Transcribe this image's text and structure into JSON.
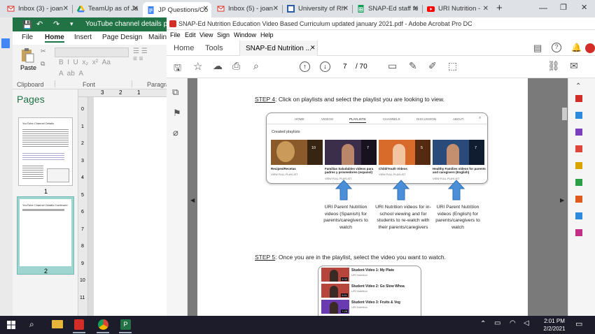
{
  "browser_tabs": [
    {
      "title": "Inbox (3) - joan",
      "icon": "gmail-icon",
      "color": "#d93025"
    },
    {
      "title": "TeamUp as of Ja",
      "icon": "google-drive-icon",
      "color": "#1a73e8"
    },
    {
      "title": "JP Questions/Co",
      "icon": "google-docs-icon",
      "color": "#4285f4"
    },
    {
      "title": "Inbox (5) - joan",
      "icon": "gmail-icon",
      "color": "#d93025"
    },
    {
      "title": "University of Rh",
      "icon": "uri-icon",
      "color": "#2a5caa"
    },
    {
      "title": "SNAP-Ed staff fe",
      "icon": "google-sheets-icon",
      "color": "#0f9d58"
    },
    {
      "title": "URI Nutrition -",
      "icon": "youtube-icon",
      "color": "#ff0000"
    }
  ],
  "publisher": {
    "title": "YouTube channel details page upd",
    "menu": [
      "File",
      "Home",
      "Insert",
      "Page Design",
      "Mailin"
    ],
    "ribbon_groups": [
      "Clipboard",
      "Font",
      "Paragrap"
    ],
    "paste_label": "Paste",
    "pages_title": "Pages",
    "page_numbers": [
      "1",
      "2"
    ],
    "thumb1_title": "YouTube Channel Details",
    "thumb2_title": "YouTube Channel Details Continued",
    "ruler_top": [
      "3",
      "2",
      "1"
    ],
    "ruler_left": [
      "0",
      "1",
      "2",
      "3",
      "4",
      "5",
      "6",
      "7",
      "8",
      "9",
      "10",
      "11"
    ]
  },
  "acrobat": {
    "title": "SNAP-Ed Nutrition Education Video Based Curriculum updated january 2021.pdf - Adobe Acrobat Pro DC",
    "menu": [
      "File",
      "Edit",
      "View",
      "Sign",
      "Window",
      "Help"
    ],
    "tabs": [
      "Home",
      "Tools",
      "SNAP-Ed Nutrition ..."
    ],
    "page_current": "7",
    "page_total": "/ 70"
  },
  "pdf": {
    "step4": "STEP 4: Click on playlists and select the playlist you are looking to view.",
    "step4_label": "STEP 4",
    "step4_text": ": Click on playlists and select the playlist you are looking to view.",
    "yt_nav": [
      "HOME",
      "VIDEOS",
      "PLAYLISTS",
      "CHANNELS",
      "DISCUSSION",
      "ABOUT"
    ],
    "created_playlists": "Created playlists",
    "playlists": [
      {
        "title": "Recipes/Recetas",
        "count": "10",
        "link": "VIEW FULL PLAYLIST",
        "color": "#8a5a2b"
      },
      {
        "title": "Familias Saludables videos para padres y proveedores (espanol)",
        "count": "7",
        "link": "VIEW FULL PLAYLIST",
        "color": "#3a2e4a"
      },
      {
        "title": "Child/Youth Videos",
        "count": "5",
        "link": "VIEW FULL PLAYLIST",
        "color": "#d86a2a"
      },
      {
        "title": "Healthy Families videos for parents and caregivers (English)",
        "count": "7",
        "link": "VIEW FULL PLAYLIST",
        "color": "#2a4a7a"
      }
    ],
    "captions": [
      "URI Parent Nutrition videos (Spanish) for parents/caregivers to watch",
      "URI Nutrition videos for in-school viewing and for students to re-watch with their parents/caregivers",
      "URI Parent Nutrition videos (English) for parents/caregivers to watch"
    ],
    "step5_label": "STEP 5",
    "step5_text": ": Once you are in the playlist, select the video you want to watch.",
    "videos": [
      {
        "title": "Student Video 1: My Plate",
        "channel": "URI Nutrition",
        "duration": "5:32"
      },
      {
        "title": "Student Video 2: Go Slow Whoa",
        "channel": "URI Nutrition",
        "duration": "5:51"
      },
      {
        "title": "Student Video 3: Fruits & Veg",
        "channel": "URI Nutrition",
        "duration": "7:29"
      }
    ]
  },
  "taskbar": {
    "time": "2:01 PM",
    "date": "2/2/2021"
  },
  "colors": {
    "accent_blue": "#4a8fd8",
    "publisher_green": "#217346",
    "acrobat_red": "#d32d27"
  }
}
